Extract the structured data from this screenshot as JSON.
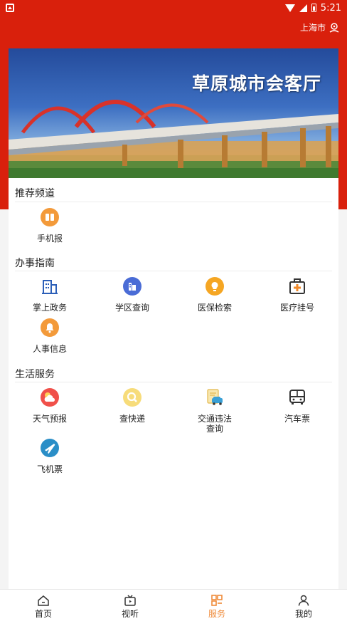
{
  "status_bar": {
    "time": "5:21"
  },
  "header": {
    "location": "上海市"
  },
  "banner": {
    "title": "草原城市会客厅"
  },
  "sections": [
    {
      "title": "推荐频道",
      "items": [
        {
          "label": "手机报",
          "icon": "newspaper-icon"
        }
      ]
    },
    {
      "title": "办事指南",
      "items": [
        {
          "label": "掌上政务",
          "icon": "government-building-icon"
        },
        {
          "label": "学区查询",
          "icon": "school-district-icon"
        },
        {
          "label": "医保检索",
          "icon": "medical-insurance-icon"
        },
        {
          "label": "医疗挂号",
          "icon": "medical-kit-icon"
        },
        {
          "label": "人事信息",
          "icon": "bell-icon"
        }
      ]
    },
    {
      "title": "生活服务",
      "items": [
        {
          "label": "天气预报",
          "icon": "weather-icon"
        },
        {
          "label": "查快递",
          "icon": "package-search-icon"
        },
        {
          "label": "交通违法\n查询",
          "icon": "traffic-violation-icon"
        },
        {
          "label": "汽车票",
          "icon": "bus-icon"
        },
        {
          "label": "飞机票",
          "icon": "airplane-icon"
        }
      ]
    }
  ],
  "tabbar": {
    "tabs": [
      {
        "label": "首页",
        "icon": "home-icon"
      },
      {
        "label": "视听",
        "icon": "tv-icon"
      },
      {
        "label": "服务",
        "icon": "services-icon",
        "active": true
      },
      {
        "label": "我的",
        "icon": "user-icon"
      }
    ]
  },
  "colors": {
    "brand_red": "#d9200c",
    "active_tab": "#ef8b3a"
  }
}
